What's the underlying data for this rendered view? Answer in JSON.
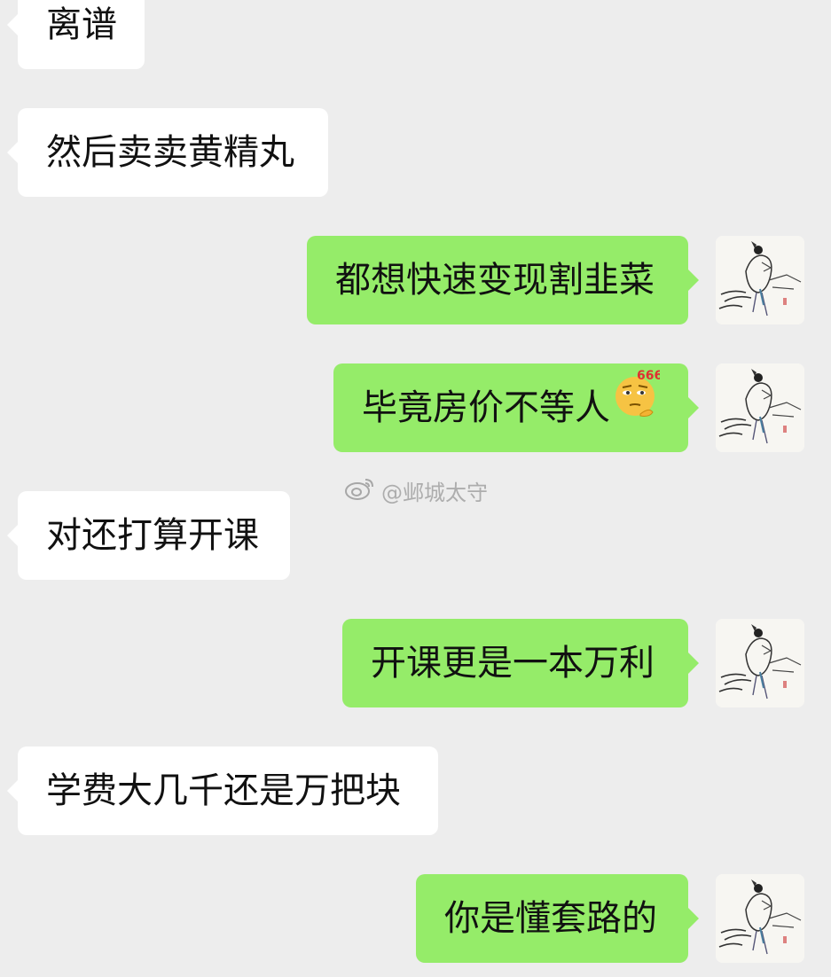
{
  "chat": {
    "messages": [
      {
        "side": "in",
        "text": "离谱"
      },
      {
        "side": "in",
        "text": "然后卖卖黄精丸"
      },
      {
        "side": "out",
        "text": "都想快速变现割韭菜"
      },
      {
        "side": "out",
        "text": "毕竟房价不等人",
        "emoji": "thinking-666-emoji"
      },
      {
        "side": "in",
        "text": "对还打算开课"
      },
      {
        "side": "out",
        "text": "开课更是一本万利"
      },
      {
        "side": "in",
        "text": "学费大几千还是万把块"
      },
      {
        "side": "out",
        "text": "你是懂套路的"
      }
    ],
    "emoji_text": "666"
  },
  "watermark": {
    "icon": "weibo-icon",
    "text": "@邺城太守"
  },
  "colors": {
    "background": "#ededed",
    "incoming_bubble": "#ffffff",
    "outgoing_bubble": "#95ec69"
  }
}
